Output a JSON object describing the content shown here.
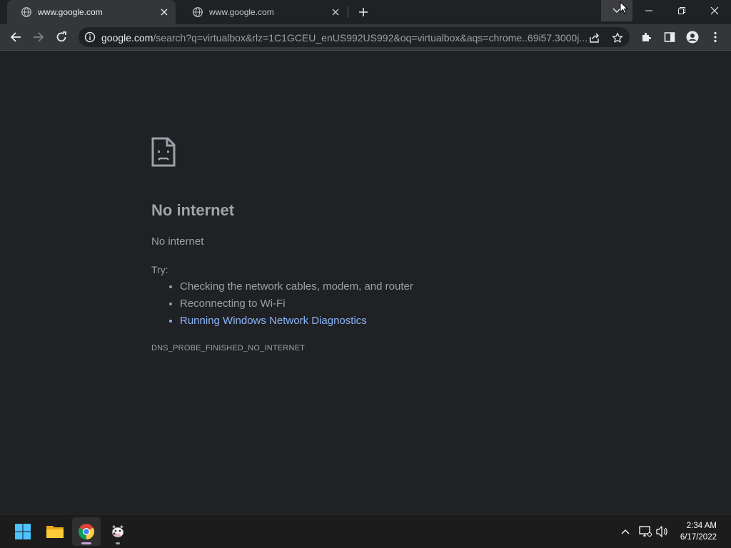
{
  "tabs": [
    {
      "title": "www.google.com",
      "active": true
    },
    {
      "title": "www.google.com",
      "active": false
    }
  ],
  "address_bar": {
    "host": "google.com",
    "path": "/search?q=virtualbox&rlz=1C1GCEU_enUS992US992&oq=virtualbox&aqs=chrome..69i57.3000j..."
  },
  "error_page": {
    "title": "No internet",
    "subtitle": "No internet",
    "try_label": "Try:",
    "suggestions": [
      "Checking the network cables, modem, and router",
      "Reconnecting to Wi-Fi",
      "Running Windows Network Diagnostics"
    ],
    "error_code": "DNS_PROBE_FINISHED_NO_INTERNET"
  },
  "taskbar": {
    "apps": [
      "start-icon",
      "file-explorer-icon",
      "chrome-icon",
      "cow-app-icon"
    ],
    "tray": [
      "chevron-up-icon",
      "network-icon",
      "volume-icon"
    ],
    "time": "2:34 AM",
    "date": "6/17/2022"
  },
  "colors": {
    "page_bg": "#202124",
    "toolbar_bg": "#35363a",
    "link": "#8ab4f8",
    "text_muted": "#9aa0a6"
  }
}
